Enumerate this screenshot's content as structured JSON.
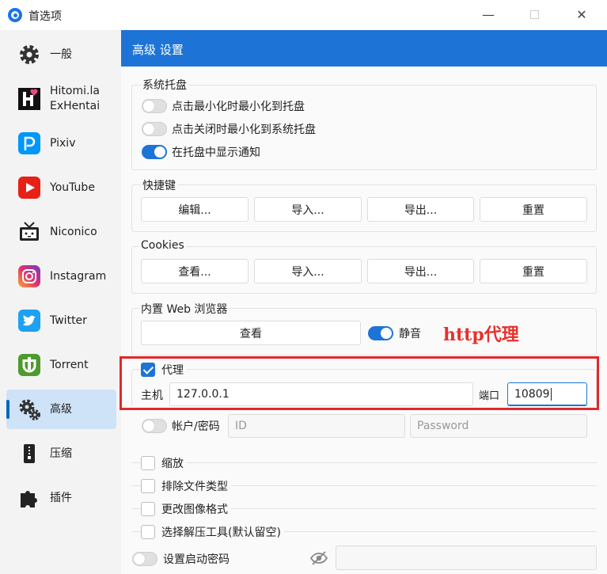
{
  "window": {
    "title": "首选项",
    "minimize": "—",
    "close": "✕"
  },
  "sidebar": {
    "items": [
      {
        "label": "一般",
        "icon": "gear-icon"
      },
      {
        "label": "Hitomi.la\nExHentai",
        "icon": "hitomi-icon"
      },
      {
        "label": "Pixiv",
        "icon": "pixiv-icon"
      },
      {
        "label": "YouTube",
        "icon": "youtube-icon"
      },
      {
        "label": "Niconico",
        "icon": "niconico-icon"
      },
      {
        "label": "Instagram",
        "icon": "instagram-icon"
      },
      {
        "label": "Twitter",
        "icon": "twitter-icon"
      },
      {
        "label": "Torrent",
        "icon": "torrent-icon"
      },
      {
        "label": "高级",
        "icon": "advanced-gears-icon",
        "active": true
      },
      {
        "label": "压缩",
        "icon": "zip-icon"
      },
      {
        "label": "插件",
        "icon": "puzzle-icon"
      }
    ]
  },
  "header": {
    "title": "高级 设置"
  },
  "tray": {
    "title": "系统托盘",
    "minimize_to_tray": "点击最小化时最小化到托盘",
    "close_to_tray": "点击关闭时最小化到系统托盘",
    "show_notification": "在托盘中显示通知"
  },
  "shortcuts": {
    "title": "快捷键",
    "edit": "编辑...",
    "import": "导入...",
    "export": "导出...",
    "reset": "重置"
  },
  "cookies": {
    "title": "Cookies",
    "view": "查看...",
    "import": "导入...",
    "export": "导出...",
    "reset": "重置"
  },
  "browser": {
    "title": "内置 Web 浏览器",
    "view": "查看",
    "mute": "静音"
  },
  "proxy": {
    "label": "代理",
    "host_label": "主机",
    "host_value": "127.0.0.1",
    "port_label": "端口",
    "port_value": "10809",
    "auth_label": "帐户/密码",
    "id_placeholder": "ID",
    "password_placeholder": "Password"
  },
  "options": {
    "zoom": "缩放",
    "exclude_types": "排除文件类型",
    "change_image_format": "更改图像格式",
    "select_extractor": "选择解压工具(默认留空)",
    "startup_password": "设置启动密码"
  },
  "annotation": {
    "text": "http代理"
  },
  "colors": {
    "accent": "#1e74d6",
    "annotation": "#e0282b"
  }
}
